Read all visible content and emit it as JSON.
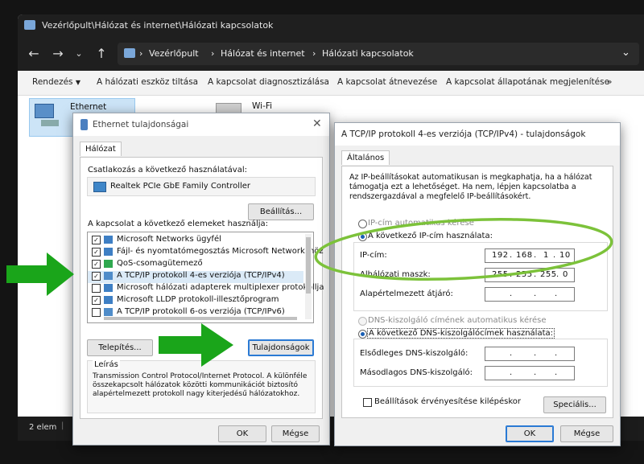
{
  "explorer": {
    "title": "Vezérlőpult\\Hálózat és internet\\Hálózati kapcsolatok",
    "crumbs": [
      "Vezérlőpult",
      "Hálózat és internet",
      "Hálózati kapcsolatok"
    ],
    "commands": [
      "Rendezés",
      "A hálózati eszköz tiltása",
      "A kapcsolat diagnosztizálása",
      "A kapcsolat átnevezése",
      "A kapcsolat állapotának megjelenítése",
      "»"
    ],
    "connections": [
      {
        "name": "Ethernet"
      },
      {
        "name": "Wi-Fi"
      }
    ],
    "status": "2 elem"
  },
  "eth": {
    "title": "Ethernet tulajdonságai",
    "tab": "Hálózat",
    "connect_label": "Csatlakozás a következő használatával:",
    "adapter": "Realtek PCIe GbE Family Controller",
    "settings_btn": "Beállítás...",
    "items_label": "A kapcsolat a következő elemeket használja:",
    "items": [
      {
        "label": "Microsoft Networks ügyfél",
        "checked": true
      },
      {
        "label": "Fájl- és nyomtatómegosztás Microsoft Networkshöz",
        "checked": true
      },
      {
        "label": "QoS-csomagütemező",
        "checked": true
      },
      {
        "label": "A TCP/IP protokoll 4-es verziója (TCP/IPv4)",
        "checked": true
      },
      {
        "label": "Microsoft hálózati adapterek multiplexer protokollja",
        "checked": false
      },
      {
        "label": "Microsoft LLDP protokoll-illesztőprogram",
        "checked": true
      },
      {
        "label": "A TCP/IP protokoll 6-os verziója (TCP/IPv6)",
        "checked": false
      }
    ],
    "install_btn": "Telepítés...",
    "props_btn": "Tulajdonságok",
    "desc_title": "Leírás",
    "desc": "Transmission Control Protocol/Internet Protocol. A különféle összekapcsolt hálózatok közötti kommunikációt biztosító alapértelmezett protokoll nagy kiterjedésű hálózatokhoz.",
    "ok": "OK",
    "cancel": "Mégse"
  },
  "ipv4": {
    "title": "A TCP/IP protokoll 4-es verziója (TCP/IPv4) - tulajdonságok",
    "tab": "Általános",
    "intro": "Az IP-beállításokat automatikusan is megkaphatja, ha a hálózat támogatja ezt a lehetőséget. Ha nem, lépjen kapcsolatba a rendszergazdával a megfelelő IP-beállításokért.",
    "auto_ip": "IP-cím automatikus kérése",
    "manual_ip": "A következő IP-cím használata:",
    "ip_label": "IP-cím:",
    "ip": [
      "192",
      "168",
      "1",
      "10"
    ],
    "mask_label": "Alhálózati maszk:",
    "mask": [
      "255",
      "255",
      "255",
      "0"
    ],
    "gw_label": "Alapértelmezett átjáró:",
    "auto_dns": "DNS-kiszolgáló címének automatikus kérése",
    "manual_dns": "A következő DNS-kiszolgálócímek használata:",
    "dns1_label": "Elsődleges DNS-kiszolgáló:",
    "dns2_label": "Másodlagos DNS-kiszolgáló:",
    "validate": "Beállítások érvényesítése kilépéskor",
    "advanced": "Speciális...",
    "ok": "OK",
    "cancel": "Mégse"
  },
  "colors": {
    "arrow": "#1aa51a",
    "highlight_ring": "#7cc23a",
    "accent": "#1a5fb4"
  }
}
